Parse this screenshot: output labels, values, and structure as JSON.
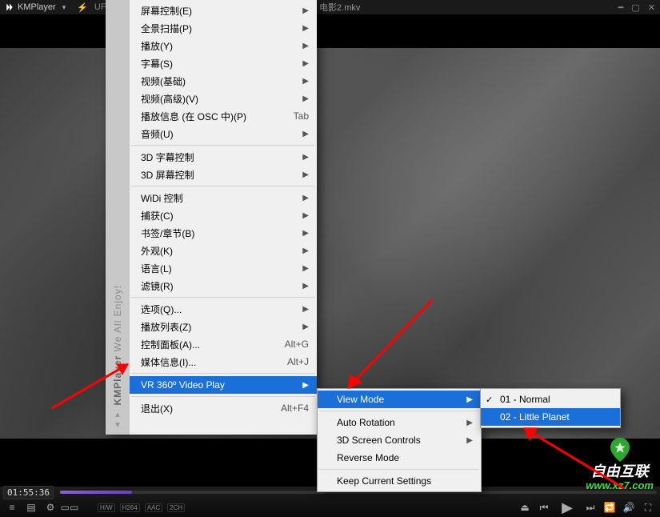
{
  "titlebar": {
    "app_name": "KMPlayer",
    "uf_label": "UF",
    "center_title": "[1/2] 电影2.mkv"
  },
  "menu": {
    "items": [
      {
        "label": "屏幕控制(E)",
        "arrow": true
      },
      {
        "label": "全景扫描(P)",
        "arrow": true
      },
      {
        "label": "播放(Y)",
        "arrow": true
      },
      {
        "label": "字幕(S)",
        "arrow": true
      },
      {
        "label": "视频(基础)",
        "arrow": true
      },
      {
        "label": "视频(高级)(V)",
        "arrow": true
      },
      {
        "label": "播放信息 (在 OSC 中)(P)",
        "shortcut": "Tab"
      },
      {
        "label": "音频(U)",
        "arrow": true
      },
      {
        "sep": true
      },
      {
        "label": "3D 字幕控制",
        "arrow": true
      },
      {
        "label": "3D 屏幕控制",
        "arrow": true
      },
      {
        "sep": true
      },
      {
        "label": "WiDi 控制",
        "arrow": true
      },
      {
        "label": "捕获(C)",
        "arrow": true
      },
      {
        "label": "书签/章节(B)",
        "arrow": true
      },
      {
        "label": "外观(K)",
        "arrow": true
      },
      {
        "label": "语言(L)",
        "arrow": true
      },
      {
        "label": "滤镜(R)",
        "arrow": true
      },
      {
        "sep": true
      },
      {
        "label": "选项(Q)...",
        "arrow": true
      },
      {
        "label": "播放列表(Z)",
        "arrow": true
      },
      {
        "label": "控制面板(A)...",
        "shortcut": "Alt+G"
      },
      {
        "label": "媒体信息(I)...",
        "shortcut": "Alt+J"
      },
      {
        "sep": true
      },
      {
        "label": "VR 360º Video Play",
        "arrow": true,
        "selected": true
      },
      {
        "sep": true
      },
      {
        "label": "退出(X)",
        "shortcut": "Alt+F4"
      }
    ],
    "sidebar_label_brand": "KMPlayer",
    "sidebar_label_sub": "We All Enjoy!"
  },
  "submenu1": {
    "items": [
      {
        "label": "View Mode",
        "arrow": true,
        "selected": true
      },
      {
        "sep": true
      },
      {
        "label": "Auto Rotation",
        "arrow": true
      },
      {
        "label": "3D Screen Controls",
        "arrow": true
      },
      {
        "label": "Reverse Mode"
      },
      {
        "sep": true
      },
      {
        "label": "Keep Current Settings"
      }
    ]
  },
  "submenu2": {
    "items": [
      {
        "label": "01 - Normal",
        "checked": true
      },
      {
        "label": "02 - Little Planet",
        "selected": true
      }
    ]
  },
  "bottom": {
    "timecode": "01:55:36",
    "tags": [
      "H/W",
      "H264",
      "AAC",
      "2CH"
    ]
  },
  "watermark": {
    "line1": "自由互联",
    "line2": "www.xz7.com"
  }
}
